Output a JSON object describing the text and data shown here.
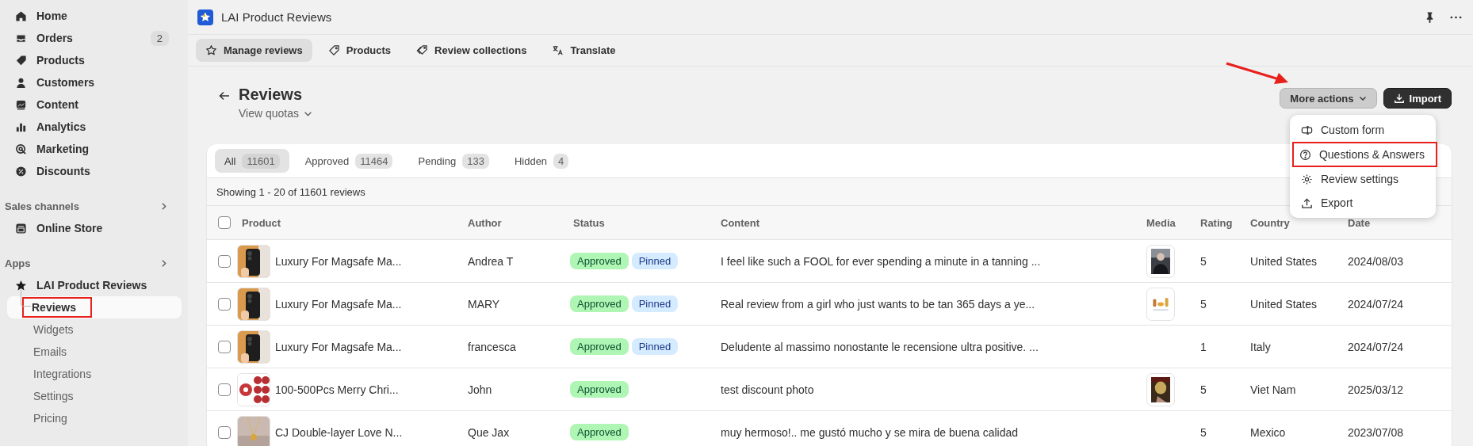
{
  "sidebar": {
    "items": [
      {
        "label": "Home"
      },
      {
        "label": "Orders",
        "badge": "2"
      },
      {
        "label": "Products"
      },
      {
        "label": "Customers"
      },
      {
        "label": "Content"
      },
      {
        "label": "Analytics"
      },
      {
        "label": "Marketing"
      },
      {
        "label": "Discounts"
      }
    ],
    "sales_channels": {
      "title": "Sales channels",
      "items": [
        {
          "label": "Online Store"
        }
      ]
    },
    "apps": {
      "title": "Apps",
      "items": [
        {
          "label": "LAI Product Reviews",
          "children": [
            {
              "label": "Reviews",
              "selected": true,
              "highlighted": true
            },
            {
              "label": "Widgets",
              "selected": false,
              "highlighted": false
            },
            {
              "label": "Emails",
              "selected": false,
              "highlighted": false
            },
            {
              "label": "Integrations",
              "selected": false,
              "highlighted": false
            },
            {
              "label": "Settings",
              "selected": false,
              "highlighted": false
            },
            {
              "label": "Pricing",
              "selected": false,
              "highlighted": false
            }
          ]
        }
      ]
    }
  },
  "app_bar": {
    "title": "LAI Product Reviews"
  },
  "nav_tabs": [
    {
      "label": "Manage reviews",
      "selected": true
    },
    {
      "label": "Products",
      "selected": false
    },
    {
      "label": "Review collections",
      "selected": false
    },
    {
      "label": "Translate",
      "selected": false
    }
  ],
  "page": {
    "title": "Reviews",
    "subtitle": "View quotas",
    "actions": [
      {
        "label": "More actions",
        "kind": "menu"
      },
      {
        "label": "Import",
        "kind": "primary"
      }
    ]
  },
  "menu": [
    {
      "label": "Custom form",
      "highlighted": false
    },
    {
      "label": "Questions & Answers",
      "highlighted": true
    },
    {
      "label": "Review settings",
      "highlighted": false
    },
    {
      "label": "Export",
      "highlighted": false
    }
  ],
  "filter_tabs": [
    {
      "label": "All",
      "count": "11601",
      "selected": true
    },
    {
      "label": "Approved",
      "count": "11464",
      "selected": false
    },
    {
      "label": "Pending",
      "count": "133",
      "selected": false
    },
    {
      "label": "Hidden",
      "count": "4",
      "selected": false
    }
  ],
  "showing": "Showing 1 - 20 of 11601 reviews",
  "table": {
    "select_all_checked": false,
    "columns": [
      "Product",
      "Author",
      "Status",
      "Content",
      "Media",
      "Rating",
      "Country",
      "Date"
    ],
    "rows": [
      {
        "checked": false,
        "product": "Luxury For Magsafe Ma...",
        "author": "Andrea T",
        "badges": [
          {
            "label": "Approved",
            "kind": "success"
          },
          {
            "label": "Pinned",
            "kind": "info"
          }
        ],
        "content": "I feel like such a FOOL for ever spending a minute in a tanning ...",
        "media": {
          "kind": "picture"
        },
        "rating": "5",
        "country": "United States",
        "date": "2024/08/03"
      },
      {
        "checked": false,
        "product": "Luxury For Magsafe Ma...",
        "author": "MARY",
        "badges": [
          {
            "label": "Approved",
            "kind": "success"
          },
          {
            "label": "Pinned",
            "kind": "info"
          }
        ],
        "content": "Real review from a girl who just wants to be tan 365 days a ye...",
        "media": {
          "kind": "picture"
        },
        "rating": "5",
        "country": "United States",
        "date": "2024/07/24"
      },
      {
        "checked": false,
        "product": "Luxury For Magsafe Ma...",
        "author": "francesca",
        "badges": [
          {
            "label": "Approved",
            "kind": "success"
          },
          {
            "label": "Pinned",
            "kind": "info"
          }
        ],
        "content": "Deludente al massimo nonostante le recensione ultra positive. ...",
        "rating": "1",
        "country": "Italy",
        "date": "2024/07/24"
      },
      {
        "checked": false,
        "product": "100-500Pcs Merry Chri...",
        "author": "John",
        "badges": [
          {
            "label": "Approved",
            "kind": "success"
          }
        ],
        "content": "test discount photo",
        "media": {
          "kind": "picture"
        },
        "rating": "5",
        "country": "Viet Nam",
        "date": "2025/03/12"
      },
      {
        "checked": false,
        "product": "CJ Double-layer Love N...",
        "author": "Que Jax",
        "badges": [
          {
            "label": "Approved",
            "kind": "success"
          }
        ],
        "content": "muy hermoso!.. me gustó mucho y se mira de buena calidad",
        "rating": "5",
        "country": "Mexico",
        "date": "2023/07/08"
      }
    ]
  }
}
